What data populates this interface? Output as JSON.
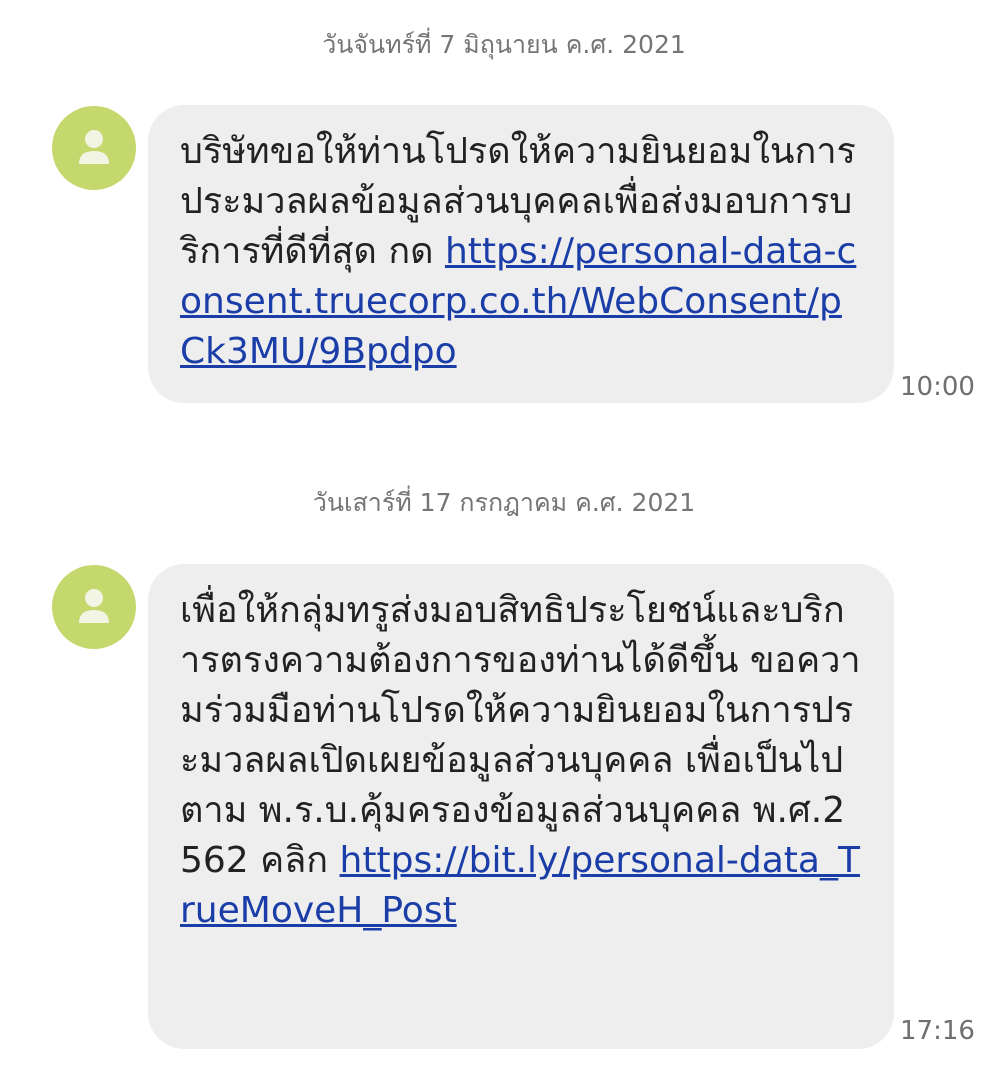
{
  "thread": {
    "messages": [
      {
        "date": "วันจันทร์ที่ 7 มิถุนายน ค.ศ. 2021",
        "text": "บริษัทขอให้ท่านโปรดให้ความยินยอมในการประมวลผลข้อมูลส่วนบุคคลเพื่อส่งมอบการบริการที่ดีที่สุด กด ",
        "link": "https://personal-data-consent.truecorp.co.th/WebConsent/pCk3MU/9Bpdpo",
        "time": "10:00"
      },
      {
        "date": "วันเสาร์ที่ 17 กรกฎาคม ค.ศ. 2021",
        "text": "เพื่อให้กลุ่มทรูส่งมอบสิทธิประโยชน์และบริการตรงความต้องการของท่านได้ดีขึ้น ขอความร่วมมือท่านโปรดให้ความยินยอมในการประมวลผลเปิดเผยข้อมูลส่วนบุคคล เพื่อเป็นไปตาม พ.ร.บ.คุ้มครองข้อมูลส่วนบุคคล พ.ศ.2562 คลิก ",
        "link": "https://bit.ly/personal-data_TrueMoveH_Post",
        "time": "17:16"
      }
    ]
  },
  "colors": {
    "avatar": "#c5d86d",
    "bubble": "#eeeeee",
    "link": "#1a3da8"
  },
  "icons": {
    "avatar": "person-icon"
  }
}
